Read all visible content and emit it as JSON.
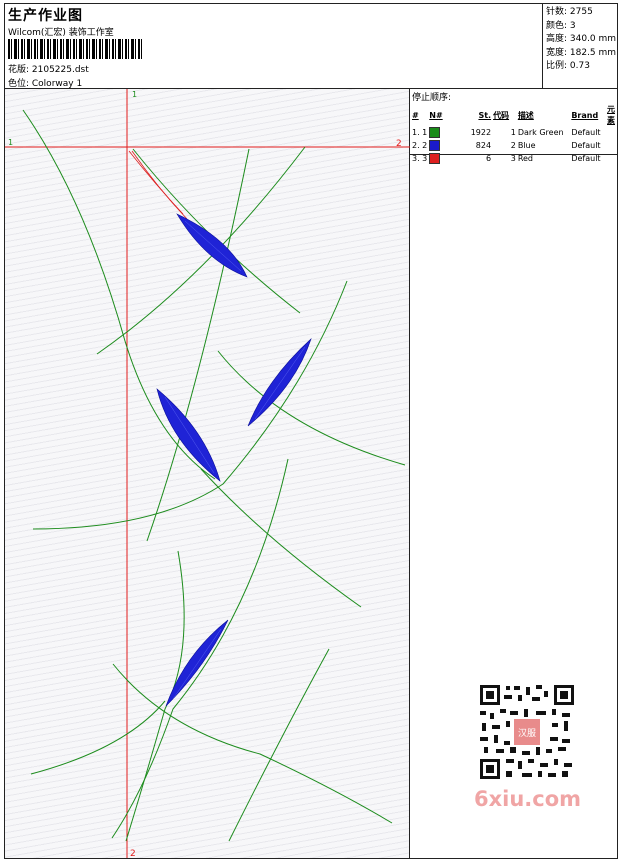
{
  "header": {
    "title": "生产作业图",
    "studio": "Wilcom(汇宏) 装饰工作室",
    "design": "花版: 2105225.dst",
    "colorway": "色位: Colorway 1"
  },
  "stats": {
    "stitches": "针数: 2755",
    "colors": "颜色: 3",
    "height": "高度: 340.0 mm",
    "width": "宽度: 182.5 mm",
    "scale": "比例: 0.73"
  },
  "stop_sequence": {
    "title": "停止顺序:",
    "columns": [
      "#",
      "N#",
      "St.",
      "代码",
      "描述",
      "Brand",
      "元素"
    ],
    "rows": [
      {
        "idx": "1. 1",
        "color": "#1a8c1a",
        "st": "1922",
        "code": "1",
        "desc": "Dark Green",
        "brand": "Default",
        "elem": ""
      },
      {
        "idx": "2. 2",
        "color": "#1a1acc",
        "st": "824",
        "code": "2",
        "desc": "Blue",
        "brand": "Default",
        "elem": ""
      },
      {
        "idx": "3. 3",
        "color": "#dd2020",
        "st": "6",
        "code": "3",
        "desc": "Red",
        "brand": "Default",
        "elem": ""
      }
    ]
  },
  "axes": {
    "v_top": "1",
    "v_bottom": "2",
    "h_left": "1",
    "h_right": "2"
  },
  "watermark": {
    "site": "6xiu.com",
    "stamp": "汉服"
  },
  "colors": {
    "green_stitch": "#1d8c1d",
    "blue_fill": "#1f23d6",
    "axis_red": "#e21b1b"
  }
}
